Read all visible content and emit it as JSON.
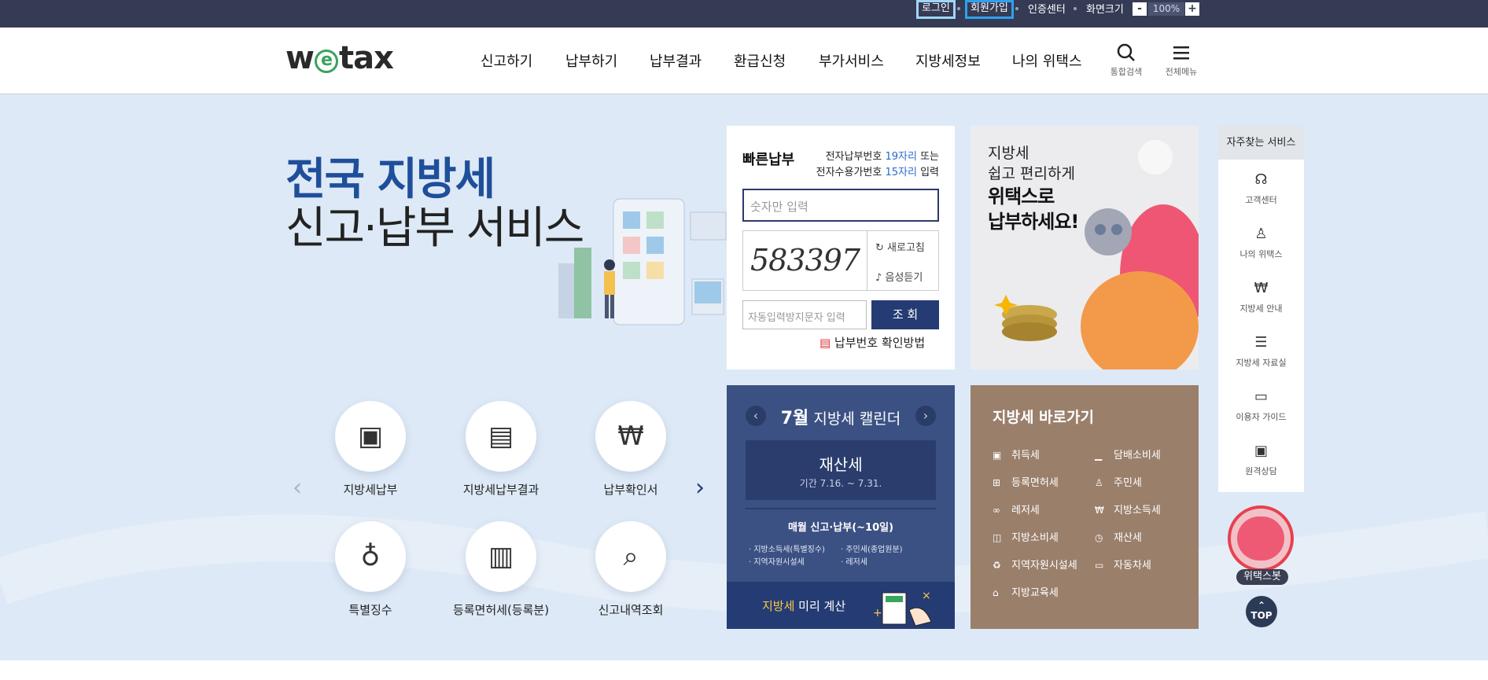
{
  "topbar": {
    "login": "로그인",
    "signup": "회원가입",
    "cert": "인증센터",
    "screen_size": "화면크기",
    "zoom_minus": "-",
    "zoom_value": "100%",
    "zoom_plus": "+",
    "marker1": "①",
    "marker2": "②"
  },
  "header": {
    "logo": {
      "w": "w",
      "e": "e",
      "rest": "tax"
    },
    "nav": [
      "신고하기",
      "납부하기",
      "납부결과",
      "환급신청",
      "부가서비스",
      "지방세정보",
      "나의 위택스"
    ],
    "search_label": "통합검색",
    "menu_label": "전체메뉴"
  },
  "hero": {
    "line1": "전국 지방세",
    "line2": "신고·납부 서비스"
  },
  "services": [
    "지방세납부",
    "지방세납부결과",
    "납부확인서",
    "특별징수",
    "등록면허세(등록분)",
    "신고내역조회"
  ],
  "quickpay": {
    "title": "빠른납부",
    "desc1_a": "전자납부번호 ",
    "desc1_b": "19자리",
    "desc1_c": " 또는",
    "desc2_a": "전자수용가번호 ",
    "desc2_b": "15자리",
    "desc2_c": " 입력",
    "number_placeholder": "숫자만 입력",
    "captcha_text": "583397",
    "refresh": "새로고침",
    "listen": "음성듣기",
    "captcha_placeholder": "자동입력방지문자 입력",
    "search_button": "조 회",
    "check_method": "납부번호 확인방법"
  },
  "promo": {
    "line1": "지방세",
    "line2": "쉽고 편리하게",
    "line3": "위택스로",
    "line4": "납부하세요!"
  },
  "calendar": {
    "month": "7월",
    "title": " 지방세 캘린더",
    "tax_name": "재산세",
    "period": "기간 7.16. ~ 7.31.",
    "monthly": "매월 신고·납부(~10일)",
    "items": [
      "지방소득세(특별징수)",
      "주민세(종업원분)",
      "지역자원시설세",
      "레저세"
    ],
    "calc_a": "지방세",
    "calc_b": " 미리 계산"
  },
  "localtax": {
    "title": "지방세 바로가기",
    "items": [
      "취득세",
      "담배소비세",
      "등록면허세",
      "주민세",
      "레저세",
      "지방소득세",
      "지방소비세",
      "재산세",
      "지역자원시설세",
      "자동차세",
      "지방교육세"
    ]
  },
  "sidebar": {
    "title": "자주찾는 서비스",
    "items": [
      "고객센터",
      "나의 위택스",
      "지방세 안내",
      "지방세 자료실",
      "이용자 가이드",
      "원격상담"
    ]
  },
  "bot_label": "위택스봇",
  "top_button": "TOP"
}
